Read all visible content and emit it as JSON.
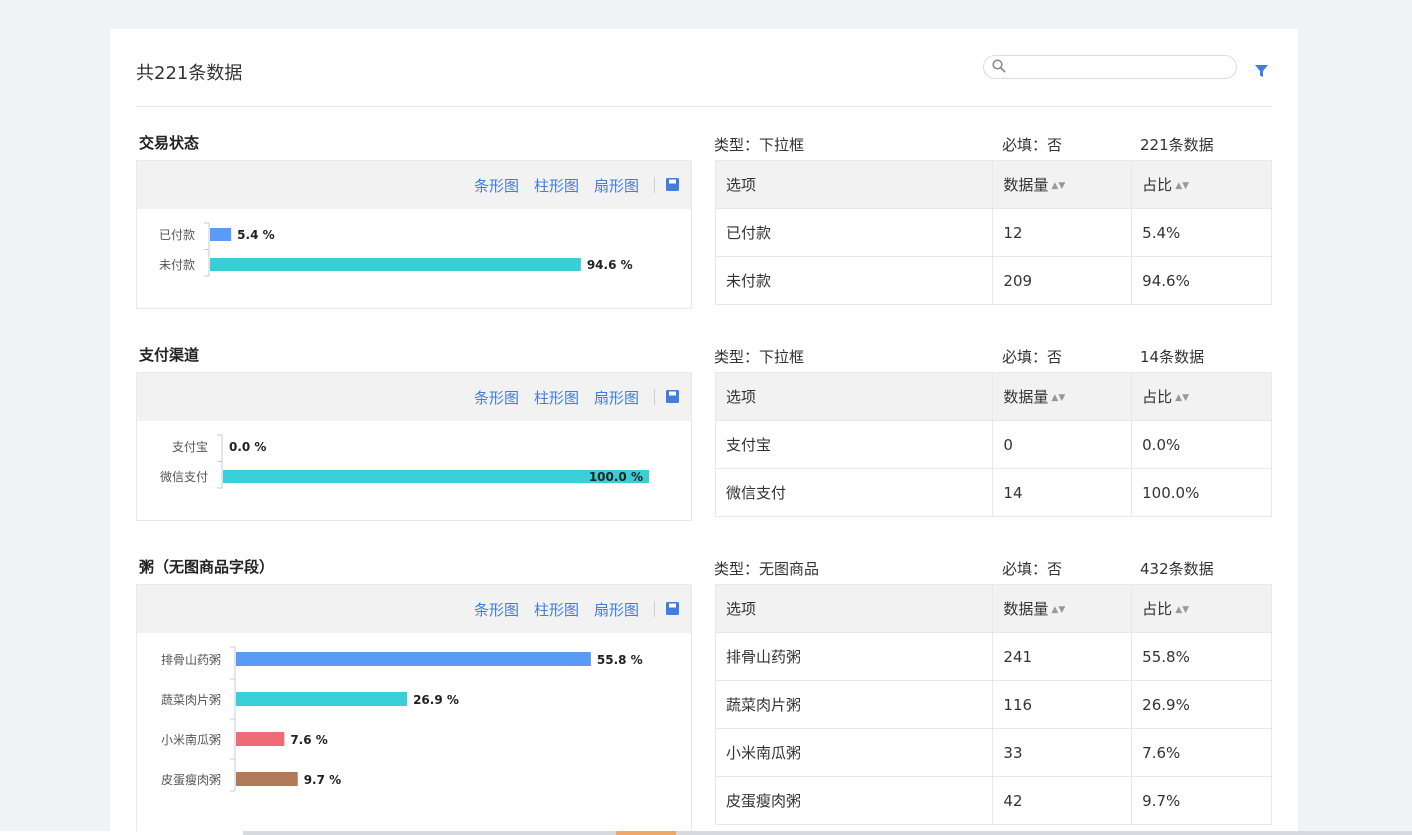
{
  "header": {
    "total_label": "共221条数据",
    "search": {
      "placeholder": "",
      "value": ""
    }
  },
  "colors": {
    "link": "#3f7de0",
    "bar_blue": "#5b9bf5",
    "bar_cyan": "#38d0d6",
    "bar_red": "#ee6b77",
    "bar_brown": "#b07a5a"
  },
  "sections": [
    {
      "title": "交易状态",
      "meta": {
        "type": "类型：下拉框",
        "required": "必填：否",
        "count": "221条数据"
      },
      "toolbar": {
        "bar": "条形图",
        "column": "柱形图",
        "pie": "扇形图"
      },
      "table": {
        "headers": [
          "选项",
          "数据量",
          "占比"
        ],
        "rows": [
          [
            "已付款",
            "12",
            "5.4%"
          ],
          [
            "未付款",
            "209",
            "94.6%"
          ]
        ]
      },
      "chart_data": {
        "type": "bar",
        "orientation": "horizontal",
        "categories": [
          "已付款",
          "未付款"
        ],
        "values": [
          5.4,
          94.6
        ],
        "value_labels": [
          "5.4 %",
          "94.6 %"
        ],
        "colors": [
          "#5b9bf5",
          "#38d0d6"
        ],
        "xlim": [
          0,
          100
        ]
      }
    },
    {
      "title": "支付渠道",
      "meta": {
        "type": "类型：下拉框",
        "required": "必填：否",
        "count": "14条数据"
      },
      "toolbar": {
        "bar": "条形图",
        "column": "柱形图",
        "pie": "扇形图"
      },
      "table": {
        "headers": [
          "选项",
          "数据量",
          "占比"
        ],
        "rows": [
          [
            "支付宝",
            "0",
            "0.0%"
          ],
          [
            "微信支付",
            "14",
            "100.0%"
          ]
        ]
      },
      "chart_data": {
        "type": "bar",
        "orientation": "horizontal",
        "categories": [
          "支付宝",
          "微信支付"
        ],
        "values": [
          0.0,
          100.0
        ],
        "value_labels": [
          "0.0 %",
          "100.0 %"
        ],
        "colors": [
          "#5b9bf5",
          "#38d0d6"
        ],
        "xlim": [
          0,
          100
        ]
      }
    },
    {
      "title": "粥（无图商品字段）",
      "meta": {
        "type": "类型：无图商品",
        "required": "必填：否",
        "count": "432条数据"
      },
      "toolbar": {
        "bar": "条形图",
        "column": "柱形图",
        "pie": "扇形图"
      },
      "table": {
        "headers": [
          "选项",
          "数据量",
          "占比"
        ],
        "rows": [
          [
            "排骨山药粥",
            "241",
            "55.8%"
          ],
          [
            "蔬菜肉片粥",
            "116",
            "26.9%"
          ],
          [
            "小米南瓜粥",
            "33",
            "7.6%"
          ],
          [
            "皮蛋瘦肉粥",
            "42",
            "9.7%"
          ]
        ]
      },
      "chart_data": {
        "type": "bar",
        "orientation": "horizontal",
        "categories": [
          "排骨山药粥",
          "蔬菜肉片粥",
          "小米南瓜粥",
          "皮蛋瘦肉粥"
        ],
        "values": [
          55.8,
          26.9,
          7.6,
          9.7
        ],
        "value_labels": [
          "55.8 %",
          "26.9 %",
          "7.6 %",
          "9.7 %"
        ],
        "colors": [
          "#5b9bf5",
          "#38d0d6",
          "#ee6b77",
          "#b07a5a"
        ],
        "xlim": [
          0,
          100
        ]
      }
    }
  ]
}
